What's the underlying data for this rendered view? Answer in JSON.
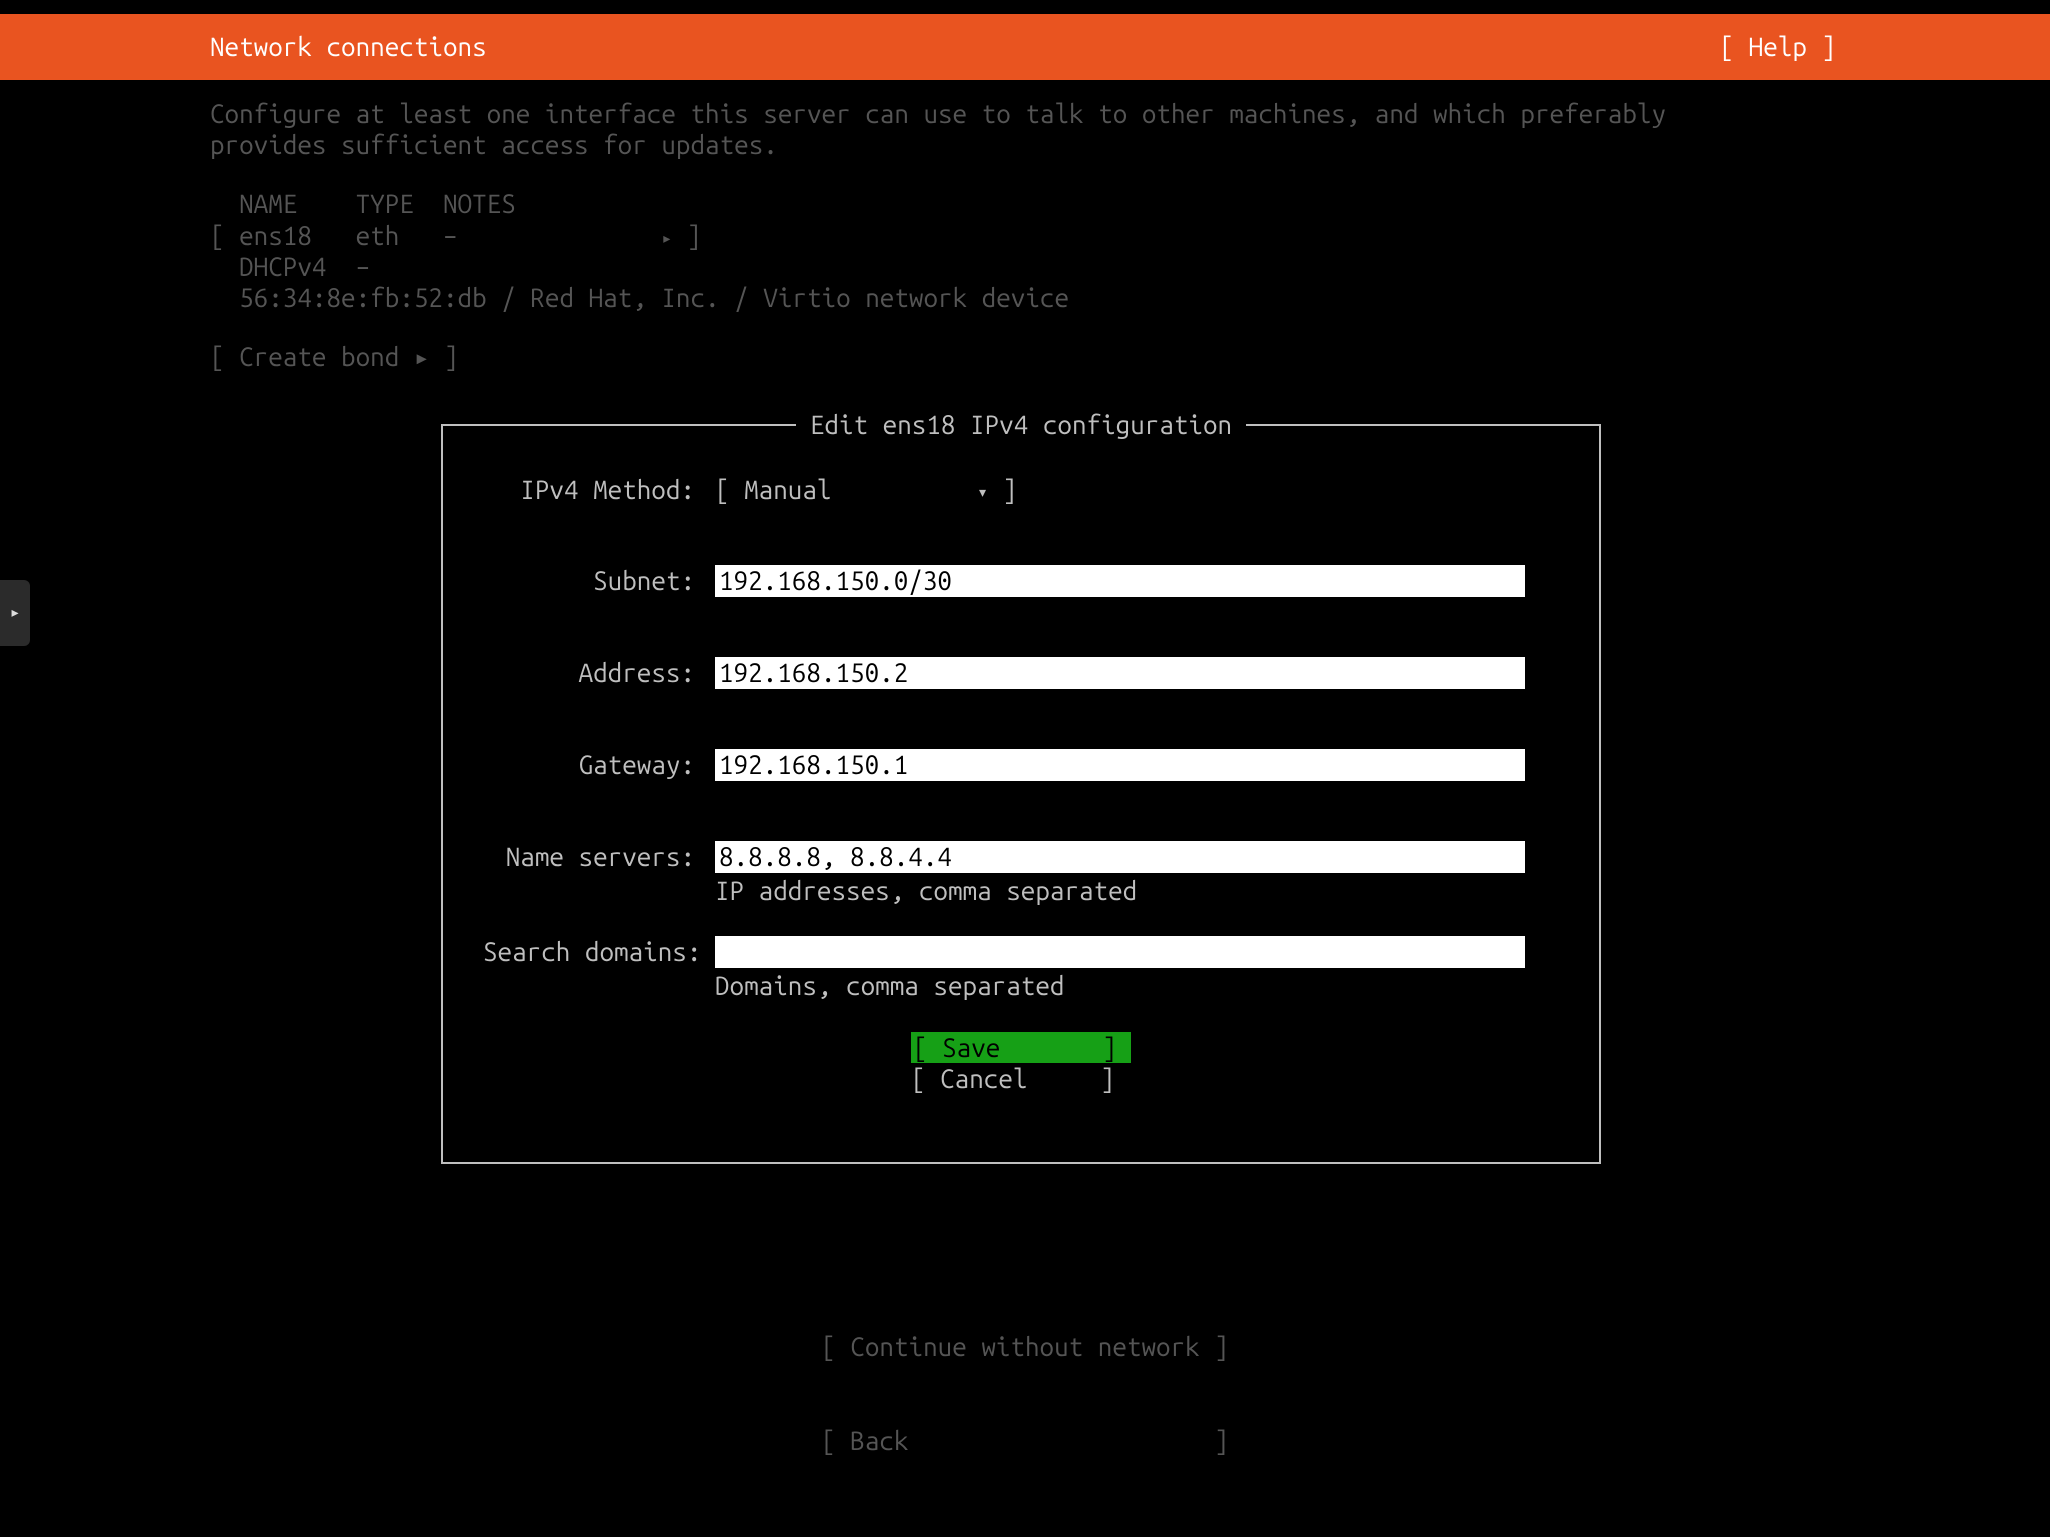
{
  "header": {
    "title": "Network connections",
    "help": "[ Help ]"
  },
  "intro": "Configure at least one interface this server can use to talk to other machines, and which preferably\nprovides sufficient access for updates.",
  "iface": {
    "col_name": "NAME",
    "col_type": "TYPE",
    "col_notes": "NOTES",
    "name": "ens18",
    "type": "eth",
    "notes": "–",
    "arrow": "▸",
    "dhcp_label": "DHCPv4",
    "dhcp_val": "–",
    "detail": "56:34:8e:fb:52:db / Red Hat, Inc. / Virtio network device"
  },
  "create_bond": "[ Create bond ▸ ]",
  "dialog": {
    "title": " Edit ens18 IPv4 configuration ",
    "method_label": "IPv4 Method:",
    "method_value": "Manual",
    "subnet_label": "Subnet:",
    "subnet_value": "192.168.150.0/30",
    "address_label": "Address:",
    "address_value": "192.168.150.2",
    "gateway_label": "Gateway:",
    "gateway_value": "192.168.150.1",
    "ns_label": "Name servers:",
    "ns_value": "8.8.8.8, 8.8.4.4",
    "ns_hint": "IP addresses, comma separated",
    "sd_label": "Search domains:",
    "sd_value": "",
    "sd_hint": "Domains, comma separated",
    "save": "[ Save       ]",
    "cancel": "[ Cancel     ]"
  },
  "footer": {
    "continue": "[ Continue without network ]",
    "back": "[ Back                     ]"
  }
}
